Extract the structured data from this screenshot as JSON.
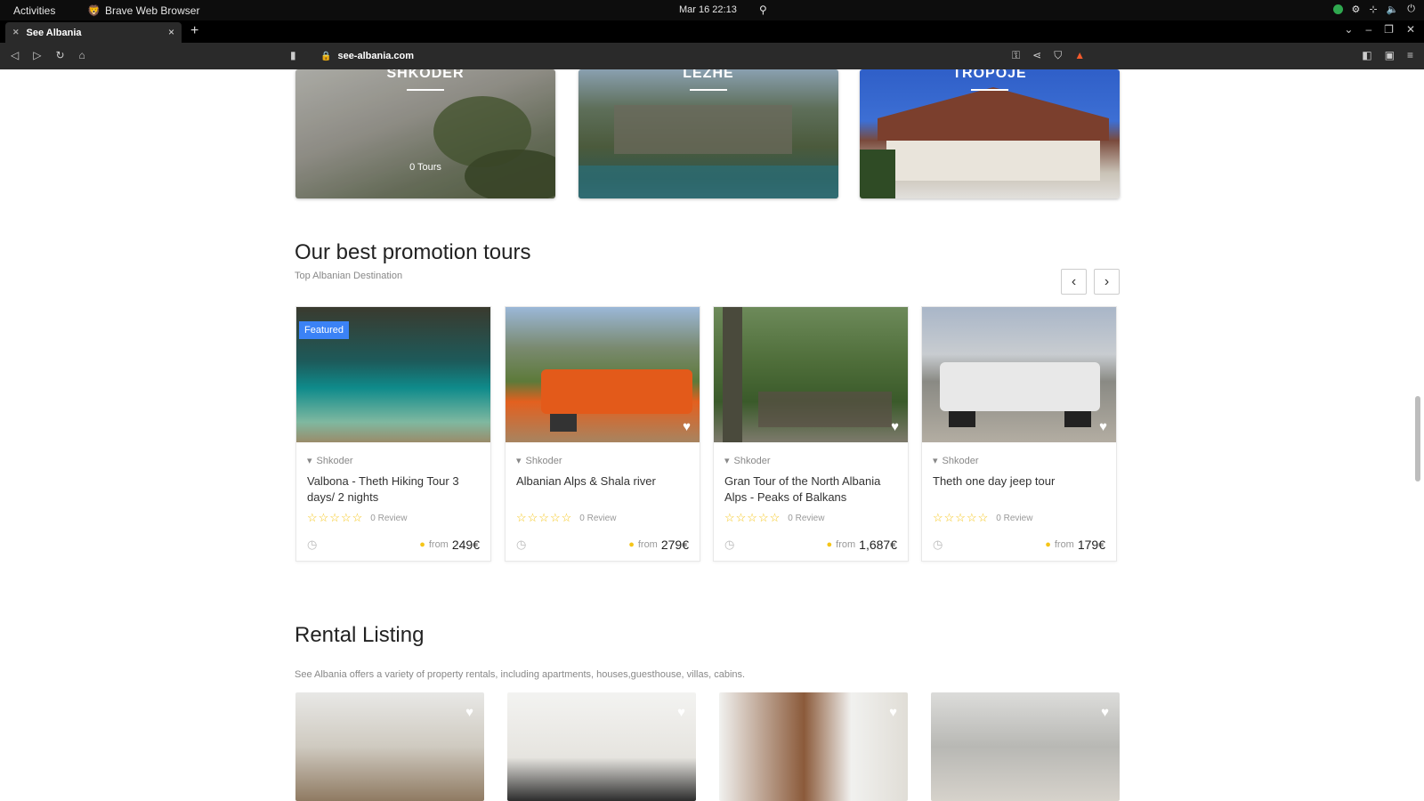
{
  "system_bar": {
    "activities": "Activities",
    "app_name": "Brave Web Browser",
    "clock": "Mar 16 22:13"
  },
  "browser": {
    "tab_title": "See Albania",
    "url": "see-albania.com"
  },
  "destinations": [
    {
      "name": "SHKODER",
      "count": "0 Tours"
    },
    {
      "name": "LEZHE",
      "count": ""
    },
    {
      "name": "TROPOJE",
      "count": ""
    }
  ],
  "promotion": {
    "title": "Our best promotion tours",
    "subtitle": "Top Albanian Destination",
    "tours": [
      {
        "badge": "Featured",
        "location": "Shkoder",
        "title": "Valbona - Theth Hiking Tour 3 days/ 2 nights",
        "reviews": "0 Review",
        "from": "from",
        "price": "249€"
      },
      {
        "badge": "",
        "location": "Shkoder",
        "title": "Albanian Alps & Shala river",
        "reviews": "0 Review",
        "from": "from",
        "price": "279€"
      },
      {
        "badge": "",
        "location": "Shkoder",
        "title": "Gran Tour of the North Albania Alps - Peaks of Balkans",
        "reviews": "0 Review",
        "from": "from",
        "price": "1,687€"
      },
      {
        "badge": "",
        "location": "Shkoder",
        "title": "Theth one day jeep tour",
        "reviews": "0 Review",
        "from": "from",
        "price": "179€"
      }
    ]
  },
  "rental": {
    "title": "Rental Listing",
    "subtitle": "See Albania offers a variety of property rentals, including apartments, houses,guesthouse, villas, cabins."
  },
  "colors": {
    "featured_badge": "#3b82f6",
    "star": "#f5c518"
  }
}
